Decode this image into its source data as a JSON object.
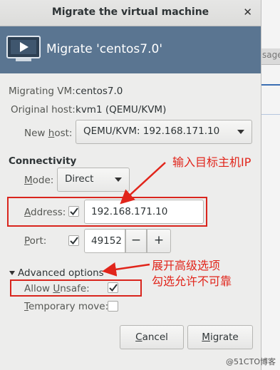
{
  "background": {
    "partial_text": "sage"
  },
  "window": {
    "title": "Migrate the virtual machine",
    "close_glyph": "✕"
  },
  "header": {
    "text": "Migrate 'centos7.0'"
  },
  "info": {
    "migrating_vm_label": "Migrating VM:",
    "migrating_vm_value": "centos7.0",
    "original_host_label": "Original host:",
    "original_host_value": "kvm1 (QEMU/KVM)",
    "new_host_label_pre": "New ",
    "new_host_label_ul": "h",
    "new_host_label_post": "ost:",
    "new_host_value": "QEMU/KVM: 192.168.171.10"
  },
  "connectivity": {
    "heading": "Connectivity",
    "mode_label_pre": "M",
    "mode_label_post": "ode:",
    "mode_value": "Direct",
    "address_label_ul": "A",
    "address_label_post": "ddress:",
    "address_checked": true,
    "address_value": "192.168.171.10",
    "port_label_ul": "P",
    "port_label_post": "ort:",
    "port_checked": true,
    "port_value": "49152",
    "minus": "−",
    "plus": "+"
  },
  "advanced": {
    "toggle_label": "Advanced options",
    "expanded": true,
    "allow_unsafe_label_ul": "U",
    "allow_unsafe_label_pre": "Allow ",
    "allow_unsafe_label_post": "nsafe:",
    "allow_unsafe_checked": true,
    "temporary_label_ul": "T",
    "temporary_label_post": "emporary move:",
    "temporary_checked": false
  },
  "buttons": {
    "cancel_ul": "C",
    "cancel_post": "ancel",
    "migrate_ul": "M",
    "migrate_post": "igrate"
  },
  "annotations": {
    "address_note": "输入目标主机IP",
    "advanced_note_line1": "展开高级选项",
    "advanced_note_line2": "勾选允许不可靠",
    "color": "#e1251b"
  },
  "watermark": "@51CTO博客"
}
